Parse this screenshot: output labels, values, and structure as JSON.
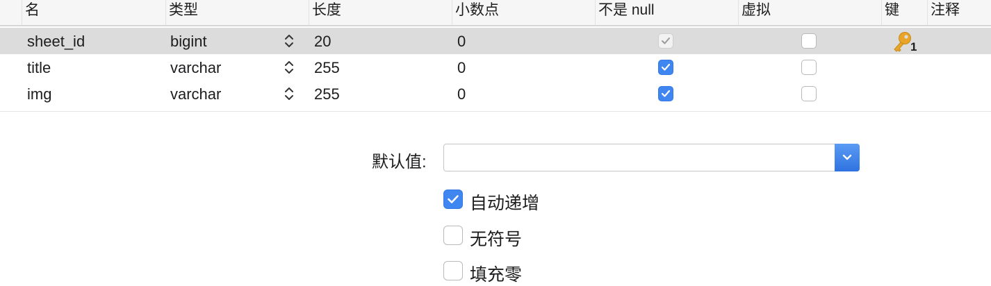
{
  "table": {
    "columns": [
      "名",
      "类型",
      "长度",
      "小数点",
      "不是 null",
      "虚拟",
      "键",
      "注释"
    ],
    "rows": [
      {
        "name": "sheet_id",
        "type": "bigint",
        "length": "20",
        "decimals": "0",
        "not_null": true,
        "virtual": false,
        "key": "1",
        "comment": ""
      },
      {
        "name": "title",
        "type": "varchar",
        "length": "255",
        "decimals": "0",
        "not_null": true,
        "virtual": false,
        "key": "",
        "comment": ""
      },
      {
        "name": "img",
        "type": "varchar",
        "length": "255",
        "decimals": "0",
        "not_null": true,
        "virtual": false,
        "key": "",
        "comment": ""
      }
    ],
    "selected_row": 0
  },
  "form": {
    "default_label": "默认值:",
    "default_value": "",
    "options": [
      {
        "label": "自动递增",
        "checked": true
      },
      {
        "label": "无符号",
        "checked": false
      },
      {
        "label": "填充零",
        "checked": false
      }
    ]
  },
  "colors": {
    "accent": "#3f86f0",
    "key_icon": "#e9a52a",
    "selected_row": "#dcdcdc"
  },
  "icons": {
    "type_stepper": "up-down-chevron-icon",
    "primary_key": "key-icon",
    "combo_dropdown": "chevron-down-icon"
  }
}
